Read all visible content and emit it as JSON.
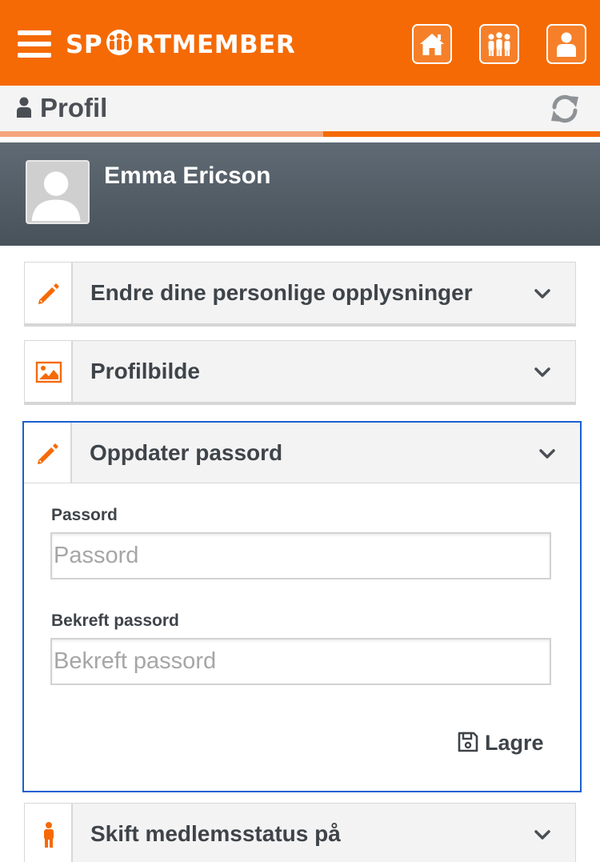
{
  "app": {
    "brand_left": "SP",
    "brand_right": "RTMEMBER",
    "accent_color": "#f56a04",
    "focus_color": "#1b5fd1"
  },
  "topbar": {
    "menu_icon": "hamburger-icon",
    "buttons": [
      "home-icon",
      "members-icon",
      "profile-icon"
    ]
  },
  "page": {
    "title": "Profil",
    "title_icon": "user-icon",
    "refresh_icon": "refresh-icon"
  },
  "profile": {
    "name": "Emma Ericson",
    "avatar_icon": "avatar-placeholder-icon"
  },
  "sections": [
    {
      "title": "Endre dine personlige opplysninger",
      "icon": "pencil-icon",
      "expanded": false
    },
    {
      "title": "Profilbilde",
      "icon": "image-icon",
      "expanded": false
    },
    {
      "title": "Oppdater passord",
      "icon": "pencil-icon",
      "expanded": true
    },
    {
      "title": "Skift medlemsstatus på",
      "icon": "person-icon",
      "expanded": false
    }
  ],
  "password_form": {
    "password_label": "Passord",
    "password_placeholder": "Passord",
    "password_value": "",
    "confirm_label": "Bekreft passord",
    "confirm_placeholder": "Bekreft passord",
    "confirm_value": "",
    "save_label": "Lagre",
    "save_icon": "floppy-disk-icon"
  }
}
